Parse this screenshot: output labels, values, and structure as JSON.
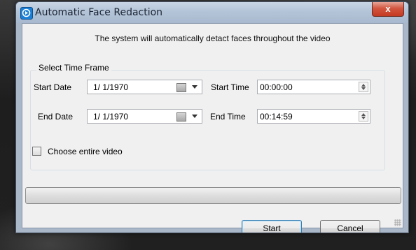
{
  "window": {
    "title": "Automatic Face Redaction",
    "close_label": "x"
  },
  "dialog": {
    "subtitle": "The system will automatically detact faces throughout the video",
    "group_title": "Select Time Frame",
    "start_date_label": "Start Date",
    "start_date_value": "1/  1/1970",
    "start_time_label": "Start Time",
    "start_time_value": "00:00:00",
    "end_date_label": "End Date",
    "end_date_value": "1/  1/1970",
    "end_time_label": "End Time",
    "end_time_value": "00:14:59",
    "entire_video_label": "Choose entire video",
    "entire_video_checked": false,
    "progress_fraction": 0.0
  },
  "buttons": {
    "start": "Start",
    "cancel": "Cancel"
  },
  "icons": {
    "app": "play-circle-icon",
    "calendar": "calendar-icon",
    "dropdown": "chevron-down-icon",
    "spinner": "spinner-arrows-icon"
  },
  "colors": {
    "accent": "#1c7fd6",
    "close": "#c53a22"
  }
}
